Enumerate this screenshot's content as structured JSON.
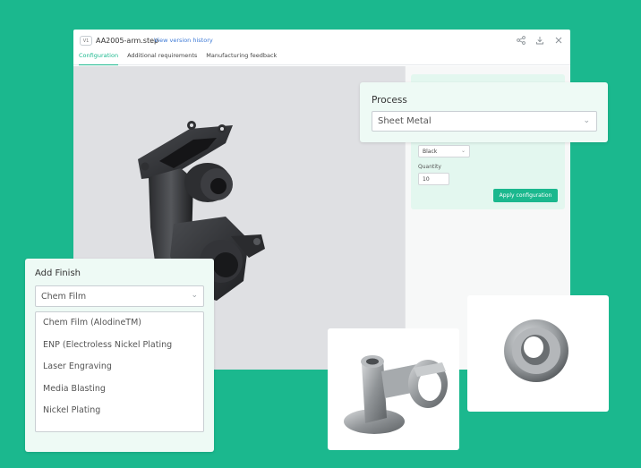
{
  "window": {
    "version_badge": "V1",
    "file_name": "AA2005-arm.step",
    "version_link": "View version history",
    "tabs": [
      {
        "label": "Configuration",
        "active": true
      },
      {
        "label": "Additional requirements",
        "active": false
      },
      {
        "label": "Manufacturing feedback",
        "active": false
      }
    ],
    "icons": [
      "share-icon",
      "download-icon",
      "close-icon"
    ]
  },
  "config": {
    "color_value": "Black",
    "quantity_label": "Quantity",
    "quantity_value": "10",
    "apply_label": "Apply configuration"
  },
  "process": {
    "label": "Process",
    "selected": "Sheet Metal"
  },
  "finish": {
    "label": "Add Finish",
    "selected": "Chem Film",
    "options": [
      "Chem Film (AlodineTM)",
      "ENP (Electroless Nickel Plating",
      "Laser Engraving",
      "Media Blasting",
      "Nickel Plating"
    ]
  },
  "colors": {
    "background": "#1bb88e",
    "accent": "#1bb88e",
    "link": "#3d7ad6"
  }
}
